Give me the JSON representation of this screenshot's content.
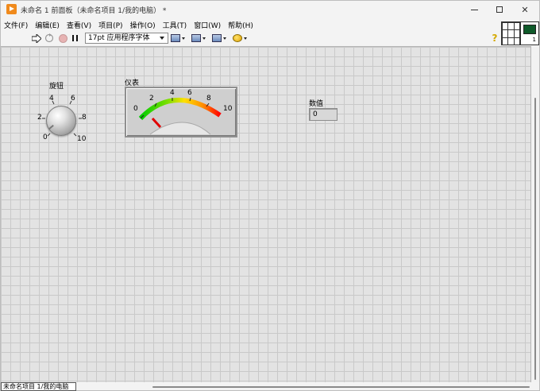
{
  "window": {
    "title": "未命名 1 前面板（未命名项目 1/我的电脑）  *",
    "minimize_glyph": "—",
    "maximize_glyph": "□",
    "close_glyph": "✕"
  },
  "menu": [
    "文件(F)",
    "编辑(E)",
    "查看(V)",
    "项目(P)",
    "操作(O)",
    "工具(T)",
    "窗口(W)",
    "帮助(H)"
  ],
  "toolbar": {
    "run_icon": "run-arrow-icon",
    "run_continuously_icon": "run-continuously-icon",
    "abort_icon": "abort-execution-icon",
    "pause_icon": "pause-icon",
    "font_select": "17pt 应用程序字体",
    "align_icon": "align-objects-icon",
    "distribute_icon": "distribute-objects-icon",
    "resize_icon": "resize-objects-icon",
    "reorder_icon": "reorder-icon",
    "help_glyph": "?"
  },
  "connector_pane": {
    "vi_icon_number": "1"
  },
  "controls": {
    "knob": {
      "label": "旋钮",
      "ticks": [
        "0",
        "2",
        "4",
        "6",
        "8",
        "10"
      ],
      "value": 0,
      "range": [
        0,
        10
      ]
    },
    "meter": {
      "label": "仪表",
      "ticks": [
        "0",
        "2",
        "4",
        "6",
        "8",
        "10"
      ],
      "value": 0,
      "range": [
        0,
        10
      ],
      "colors": {
        "low": "#00cc00",
        "mid": "#ffe000",
        "high": "#ff0000",
        "needle": "#e00000"
      }
    },
    "numeric": {
      "label": "数值",
      "value": "0"
    }
  },
  "status": {
    "context": "未命名项目 1/我的电脑"
  }
}
